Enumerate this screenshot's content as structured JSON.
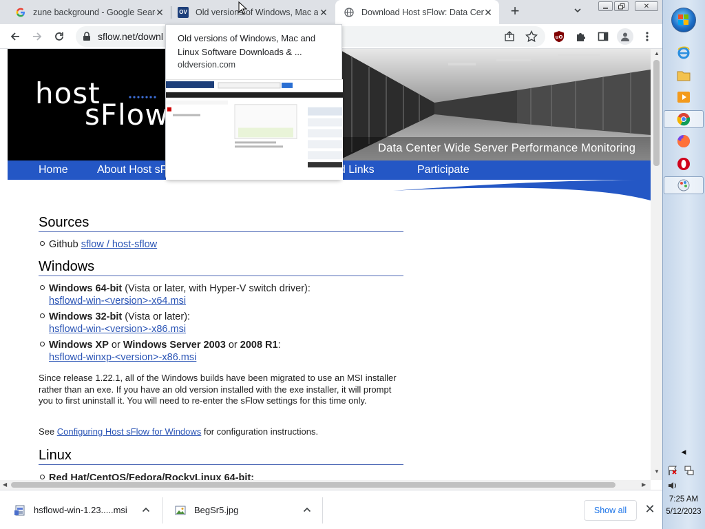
{
  "tabs": [
    {
      "title": "zune background - Google Searc",
      "favicon": "google-icon"
    },
    {
      "title": "Old versions of Windows, Mac ar",
      "favicon": "oldversion-icon"
    },
    {
      "title": "Download Host sFlow: Data Cent",
      "favicon": "globe-icon"
    }
  ],
  "address_bar": {
    "url": "sflow.net/downl"
  },
  "hovercard": {
    "title": "Old versions of Windows, Mac and Linux Software Downloads & ...",
    "domain": "oldversion.com"
  },
  "page": {
    "logo_host": "host",
    "logo_sflow": "sFlow",
    "tagline": "Data Center Wide Server Performance Monitoring",
    "nav": [
      "Home",
      "About Host sF",
      "ed Links",
      "Participate"
    ],
    "sections": {
      "sources": "Sources",
      "windows": "Windows",
      "linux": "Linux"
    },
    "sources_item": {
      "prefix": "Github ",
      "link": "sflow / host-sflow"
    },
    "win64": {
      "bold": "Windows 64-bit",
      "rest": " (Vista or later, with Hyper-V switch driver):",
      "link": "hsflowd-win-<version>-x64.msi"
    },
    "win32": {
      "bold": "Windows 32-bit",
      "rest": " (Vista or later):",
      "link": "hsflowd-win-<version>-x86.msi"
    },
    "winxp": {
      "bold1": "Windows XP",
      "or1": " or ",
      "bold2": "Windows Server 2003",
      "or2": " or ",
      "bold3": "2008 R1",
      "colon": ":",
      "link": "hsflowd-winxp-<version>-x86.msi"
    },
    "msi_note": "Since release 1.22.1, all of the Windows builds have been migrated to use an MSI installer rather than an exe. If you have an old version installed with the exe installer, it will prompt you to first uninstall it. You will need to re-enter the sFlow settings for this time only.",
    "config": {
      "prefix": "See ",
      "link": "Configuring Host sFlow for Windows",
      "suffix": " for configuration instructions."
    },
    "linux_item": "Red Hat/CentOS/Fedora/RockyLinux 64-bit:"
  },
  "downloads": [
    {
      "name": "hsflowd-win-1.23.....msi",
      "icon": "installer-icon"
    },
    {
      "name": "BegSr5.jpg",
      "icon": "image-file-icon"
    }
  ],
  "download_bar": {
    "show_all": "Show all"
  },
  "clock": {
    "time": "7:25 AM",
    "date": "5/12/2023"
  }
}
